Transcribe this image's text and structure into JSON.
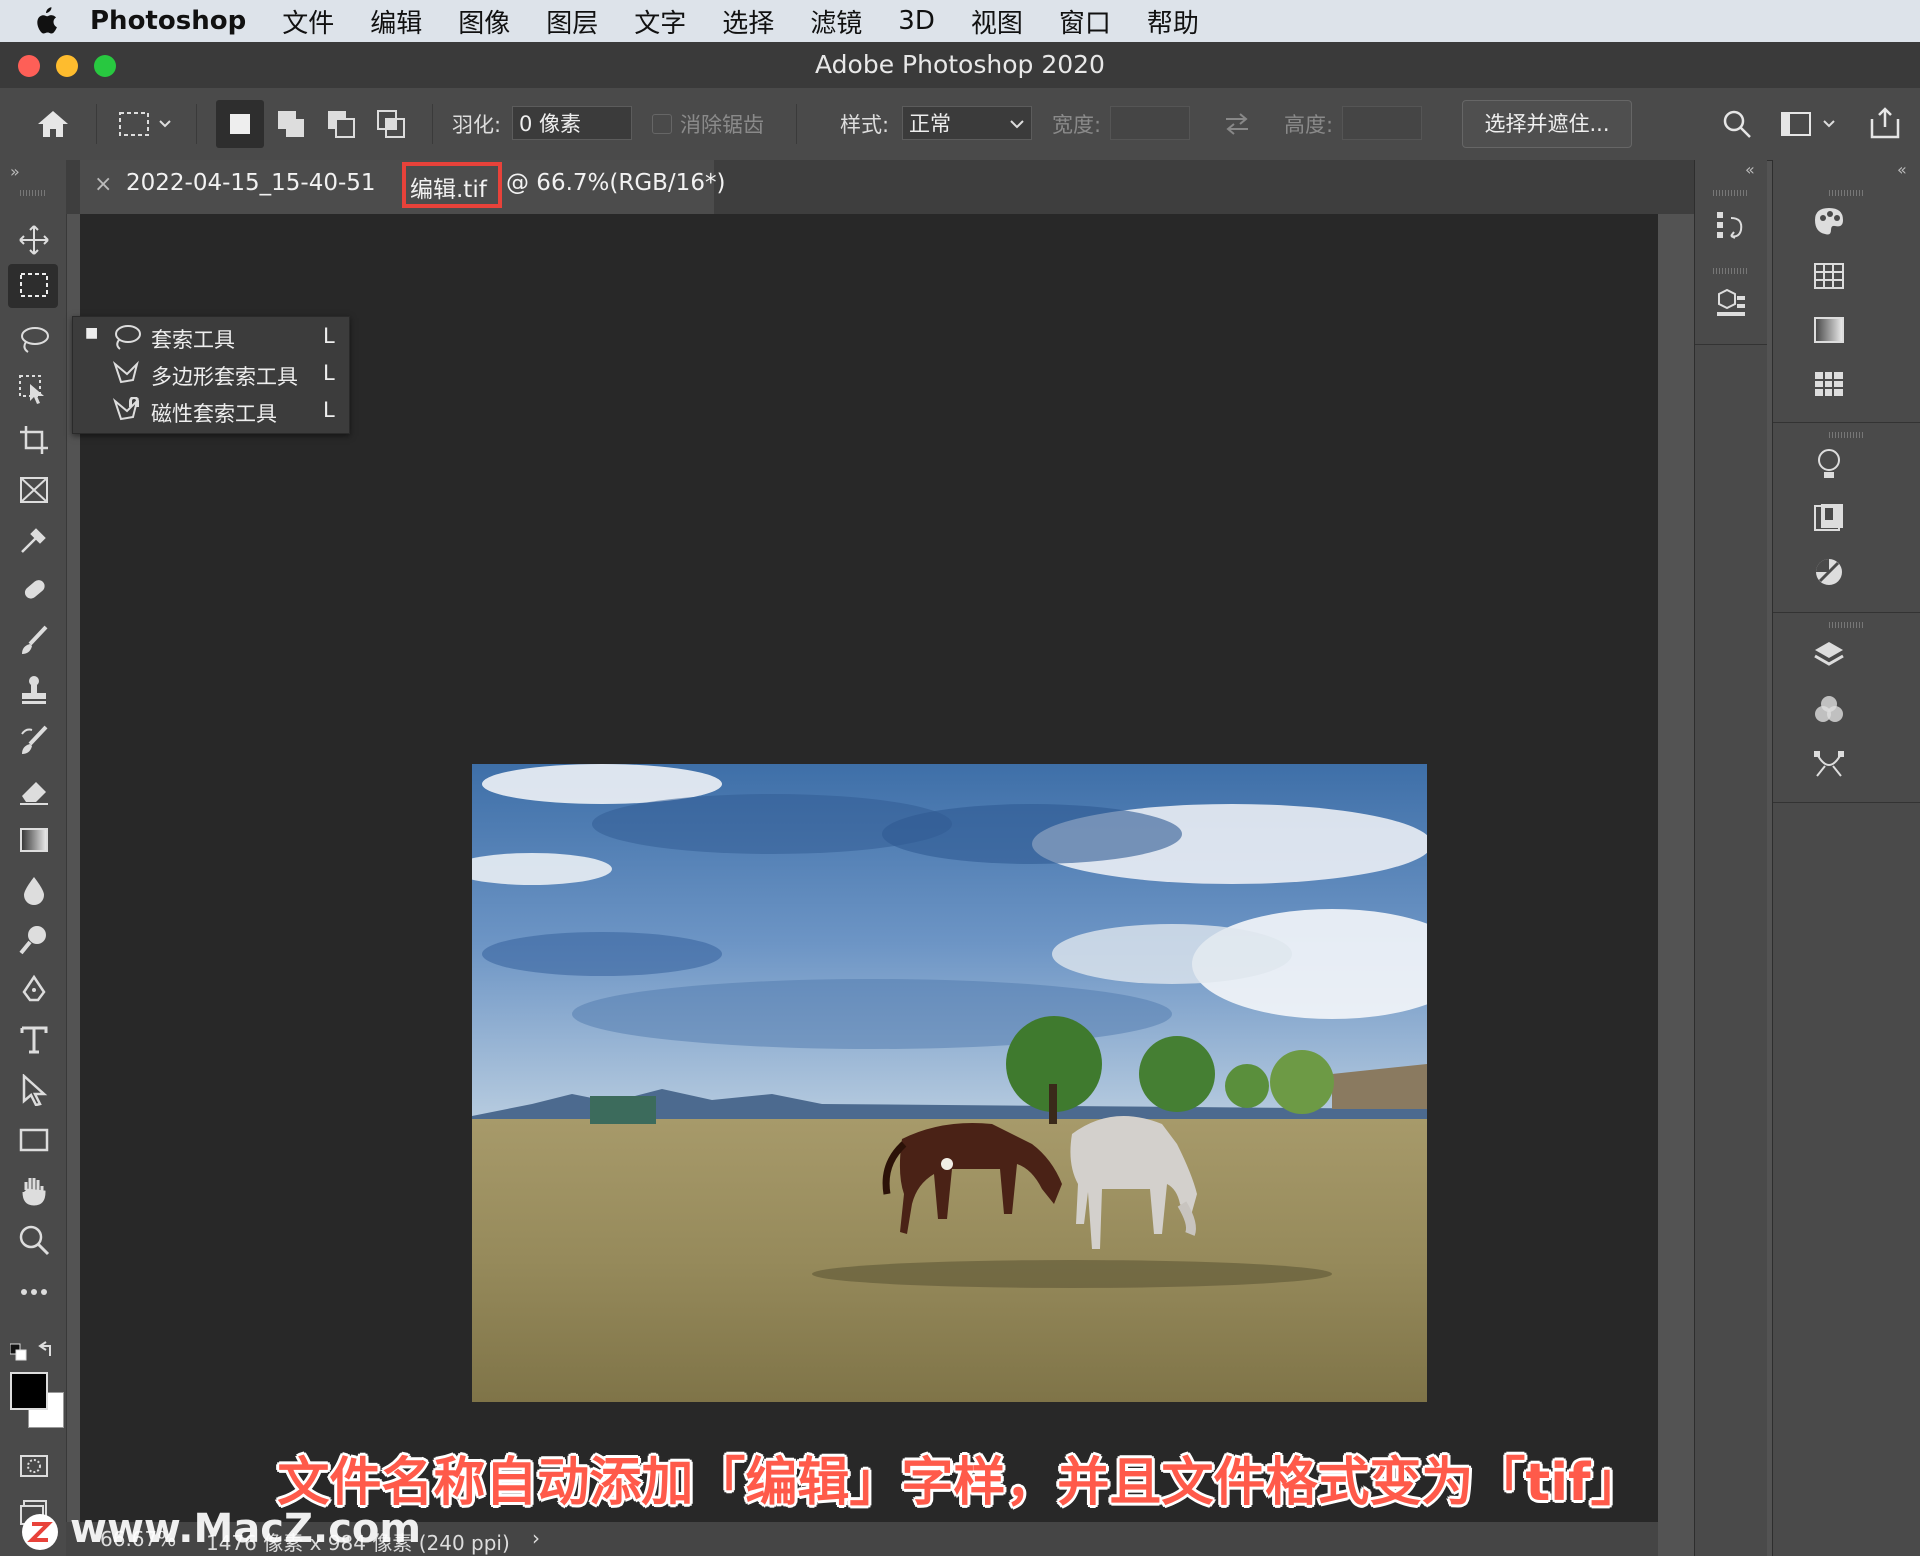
{
  "menubar": {
    "app_name": "Photoshop",
    "items": [
      "文件",
      "编辑",
      "图像",
      "图层",
      "文字",
      "选择",
      "滤镜",
      "3D",
      "视图",
      "窗口",
      "帮助"
    ]
  },
  "window": {
    "title": "Adobe Photoshop 2020"
  },
  "options_bar": {
    "feather_label": "羽化:",
    "feather_value": "0 像素",
    "antialias_label": "消除锯齿",
    "style_label": "样式:",
    "style_value": "正常",
    "width_label": "宽度:",
    "height_label": "高度:",
    "select_mask_button": "选择并遮住..."
  },
  "document_tab": {
    "name_prefix": "2022-04-15_15-40-51",
    "name_highlight": "编辑.tif",
    "name_suffix": "@ 66.7%(RGB/16*)"
  },
  "tool_flyout": {
    "items": [
      {
        "label": "套索工具",
        "shortcut": "L",
        "selected": true
      },
      {
        "label": "多边形套索工具",
        "shortcut": "L",
        "selected": false
      },
      {
        "label": "磁性套索工具",
        "shortcut": "L",
        "selected": false
      }
    ]
  },
  "status_bar": {
    "zoom": "66.67%",
    "dimensions": "1476 像素 x 984 像素 (240 ppi)"
  },
  "caption": "文件名称自动添加「编辑」字样，并且文件格式变为「tif」",
  "watermark": "www.MacZ.com",
  "colors": {
    "highlight": "#e8423a",
    "caption": "#ff5a4a",
    "canvas": "#282828",
    "panel": "#4a4a4a"
  }
}
